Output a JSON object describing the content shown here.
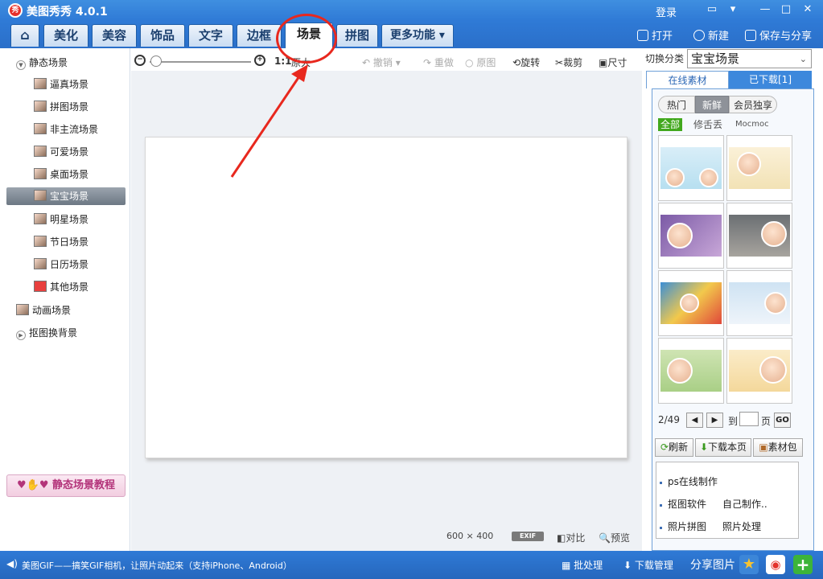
{
  "app": {
    "title": "美图秀秀 4.0.1",
    "logo_text": "秀",
    "login": "登录"
  },
  "tabs": [
    "美化",
    "美容",
    "饰品",
    "文字",
    "边框",
    "场景",
    "拼图",
    "更多功能"
  ],
  "toolbar_right": {
    "open": "打开",
    "new": "新建",
    "save_share": "保存与分享"
  },
  "left_tree": {
    "static_root": "静态场景",
    "items": [
      "逼真场景",
      "拼图场景",
      "非主流场景",
      "可爱场景",
      "桌面场景",
      "宝宝场景",
      "明星场景",
      "节日场景",
      "日历场景",
      "其他场景"
    ],
    "animated": "动画场景",
    "cutout_bg": "抠图换背景",
    "tutorial": "静态场景教程"
  },
  "edit_toolbar": {
    "one_to_one": "1:1",
    "original_size": "原大",
    "undo": "撤销",
    "redo": "重做",
    "original": "原图",
    "rotate": "旋转",
    "crop": "裁剪",
    "size": "尺寸"
  },
  "canvas_info": {
    "dimensions": "600 × 400",
    "exif": "EXIF",
    "compare": "对比",
    "preview": "预览"
  },
  "right_panel": {
    "category_label": "切换分类",
    "category_value": "宝宝场景",
    "tab_online": "在线素材",
    "tab_downloaded": "已下载[1]",
    "pills": [
      "热门",
      "新鲜",
      "会员独享"
    ],
    "filters": [
      "全部",
      "修舌丢",
      "Mocmoc"
    ],
    "page_indicator": "2/49",
    "go_to": "到",
    "page": "页",
    "go": "GO",
    "refresh": "刷新",
    "download_page": "下载本页",
    "material_pack": "素材包",
    "links": [
      "ps在线制作",
      "抠图软件",
      "自己制作..",
      "照片拼图",
      "照片处理"
    ]
  },
  "status": {
    "message": "美图GIF——搞笑GIF相机，让照片动起来（支持iPhone、Android）",
    "batch": "批处理",
    "download_manager": "下载管理",
    "share_image": "分享图片"
  }
}
